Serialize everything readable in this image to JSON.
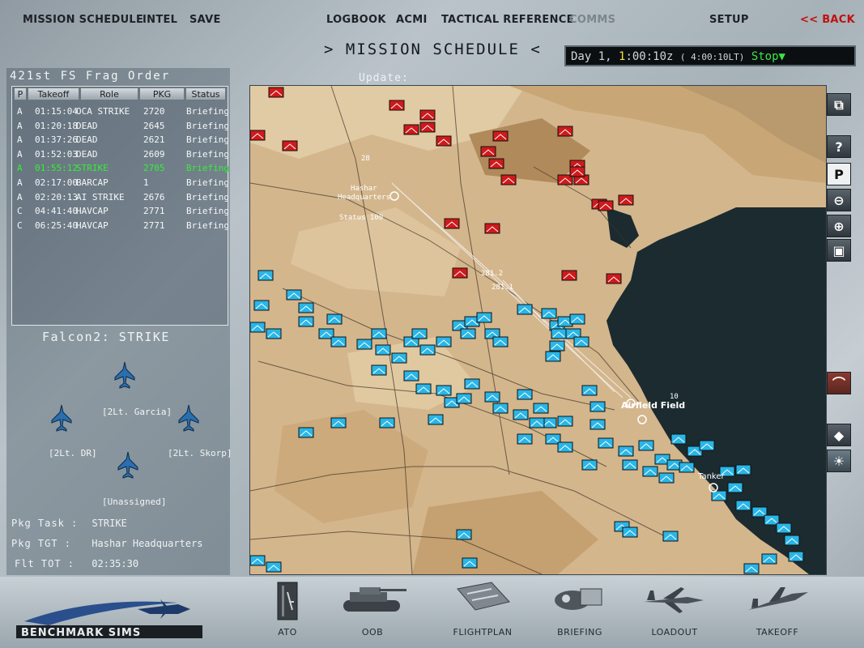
{
  "top_menu": {
    "mission_schedule": "MISSION SCHEDULE",
    "intel": "INTEL",
    "save": "SAVE",
    "logbook": "LOGBOOK",
    "acmi": "ACMI",
    "tactical_reference": "TACTICAL REFERENCE",
    "comms": "COMMS",
    "setup": "SETUP",
    "back": "<< BACK"
  },
  "page_title": ">  MISSION SCHEDULE  <",
  "clock": {
    "day_label": "Day 1,",
    "hour": "1",
    "time_rest": ":00:10z",
    "local": "( 4:00:10LT)",
    "mode": "Stop"
  },
  "frag_order": {
    "title": "421st FS Frag Order",
    "columns": [
      "P",
      "Takeoff",
      "Role",
      "PKG",
      "Status"
    ],
    "rows": [
      {
        "p": "A",
        "takeoff": "01:15:04",
        "role": "OCA STRIKE",
        "pkg": "2720",
        "status": "Briefing"
      },
      {
        "p": "A",
        "takeoff": "01:20:18",
        "role": "DEAD",
        "pkg": "2645",
        "status": "Briefing"
      },
      {
        "p": "A",
        "takeoff": "01:37:26",
        "role": "DEAD",
        "pkg": "2621",
        "status": "Briefing"
      },
      {
        "p": "A",
        "takeoff": "01:52:03",
        "role": "DEAD",
        "pkg": "2609",
        "status": "Briefing"
      },
      {
        "p": "A",
        "takeoff": "01:55:12",
        "role": "STRIKE",
        "pkg": "2705",
        "status": "Briefing"
      },
      {
        "p": "A",
        "takeoff": "02:17:00",
        "role": "BARCAP",
        "pkg": "1",
        "status": "Briefing"
      },
      {
        "p": "A",
        "takeoff": "02:20:13",
        "role": "AI STRIKE",
        "pkg": "2676",
        "status": "Briefing"
      },
      {
        "p": "C",
        "takeoff": "04:41:40",
        "role": "HAVCAP",
        "pkg": "2771",
        "status": "Briefing"
      },
      {
        "p": "C",
        "takeoff": "06:25:40",
        "role": "HAVCAP",
        "pkg": "2771",
        "status": "Briefing"
      }
    ],
    "selected_row": 4
  },
  "flight": {
    "title": "Falcon2: STRIKE",
    "pilots": {
      "lead": "",
      "wing2": "[2Lt. Garcia]",
      "element": "[2Lt. DR]",
      "wing4": "[2Lt. Skorp]",
      "unassigned": "[Unassigned]"
    },
    "pkg_task_label": "Pkg Task :",
    "pkg_task": "STRIKE",
    "pkg_tgt_label": "Pkg TGT :",
    "pkg_tgt": "Hashar Headquarters",
    "flt_tot_label": "Flt TOT :",
    "flt_tot": "02:35:30"
  },
  "map": {
    "update_label": "Update:",
    "labels": {
      "hashar": "Hashar",
      "headquarters": "Headquarters",
      "status": "Status 100",
      "airfield": "Airfield Field",
      "tanker": "Tanker",
      "n1": "281.2",
      "n2": "281.1",
      "n3": "10",
      "n4": "28"
    },
    "colors": {
      "land": "#d2b48c",
      "sea": "#1b2b30",
      "friendly": "#29b6e8",
      "enemy": "#d0191b"
    }
  },
  "map_tools": [
    "zoom-window-icon",
    "help-icon",
    "pause-icon",
    "zoom-out-icon",
    "zoom-in-icon",
    "fit-icon",
    "terrain-icon",
    "layer-icon",
    "weather-icon"
  ],
  "bottom_nav": {
    "logo": "BENCHMARK SIMS",
    "ato": "ATO",
    "oob": "OOB",
    "flightplan": "FLIGHTPLAN",
    "briefing": "BRIEFING",
    "loadout": "LOADOUT",
    "takeoff": "TAKEOFF"
  }
}
